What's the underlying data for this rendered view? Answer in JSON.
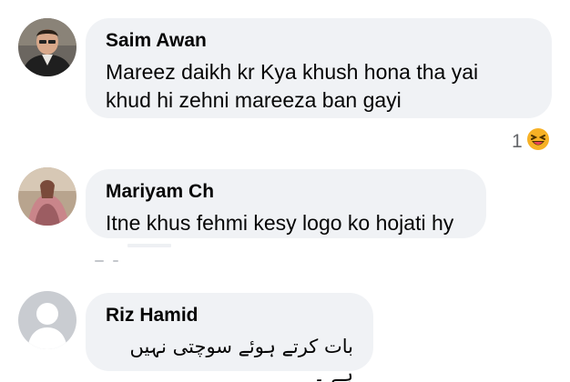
{
  "comments": [
    {
      "author": "Saim Awan",
      "lines": [
        "Mareez daikh kr Kya khush hona tha yai",
        "khud hi zehni mareeza ban gayi"
      ],
      "reaction": {
        "count": "1",
        "icon": "laughing-emoji-icon",
        "color": "#f7b125"
      }
    },
    {
      "author": "Mariyam Ch",
      "lines": [
        "Itne khus fehmi kesy logo ko hojati hy"
      ]
    },
    {
      "author": "Riz Hamid",
      "lines": [
        "بات کرتے ہوئے سوچتی نہیں ہے ۔"
      ]
    }
  ],
  "colors": {
    "bubble": "#f0f2f5",
    "text": "#050505",
    "muted": "#65676b",
    "default_avatar_bg": "#c9ccd1"
  }
}
